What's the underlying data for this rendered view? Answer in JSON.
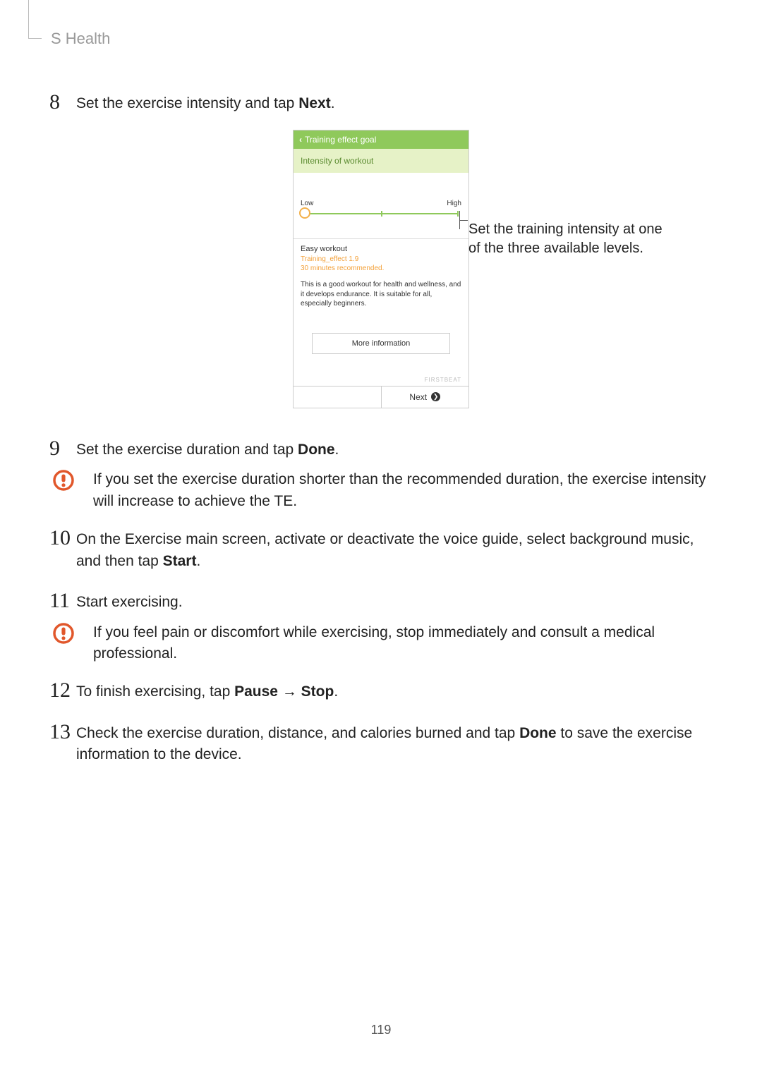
{
  "header": {
    "section_title": "S Health"
  },
  "steps": {
    "s8": {
      "num": "8",
      "text_a": "Set the exercise intensity and tap ",
      "bold": "Next",
      "text_b": "."
    },
    "s9": {
      "num": "9",
      "text_a": "Set the exercise duration and tap ",
      "bold": "Done",
      "text_b": "."
    },
    "s10": {
      "num": "10",
      "text_a": "On the Exercise main screen, activate or deactivate the voice guide, select background music, and then tap ",
      "bold": "Start",
      "text_b": "."
    },
    "s11": {
      "num": "11",
      "text": "Start exercising."
    },
    "s12": {
      "num": "12",
      "text_a": "To finish exercising, tap ",
      "bold1": "Pause",
      "arrow": " → ",
      "bold2": "Stop",
      "text_b": "."
    },
    "s13": {
      "num": "13",
      "text_a": "Check the exercise duration, distance, and calories burned and tap ",
      "bold": "Done",
      "text_b": " to save the exercise information to the device."
    }
  },
  "warnings": {
    "w1": "If you set the exercise duration shorter than the recommended duration, the exercise intensity will increase to achieve the TE.",
    "w2": "If you feel pain or discomfort while exercising, stop immediately and consult a medical professional."
  },
  "phone": {
    "title": "Training effect goal",
    "subtitle": "Intensity of workout",
    "slider_low": "Low",
    "slider_high": "High",
    "workout_title": "Easy workout",
    "workout_sub1": "Training_effect 1.9",
    "workout_sub2": "30 minutes recommended.",
    "workout_desc": "This is a good workout for health and wellness, and it develops endurance. It is suitable for all, especially beginners.",
    "more_info": "More information",
    "firstbeat": "FIRSTBEAT",
    "next": "Next"
  },
  "callout": {
    "line1": "Set the training intensity at one",
    "line2": "of the three available levels."
  },
  "page_number": "119"
}
